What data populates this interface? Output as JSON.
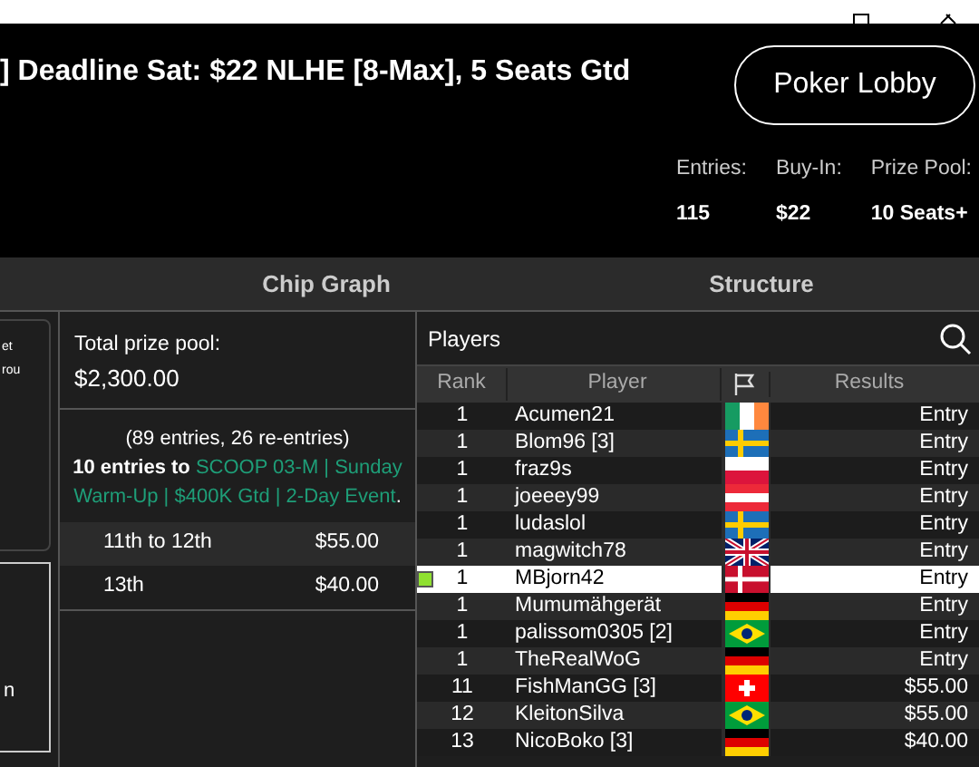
{
  "title": "] Deadline Sat: $22 NLHE [8-Max], 5 Seats Gtd",
  "lobby_button": "Poker Lobby",
  "stats": [
    {
      "label": "Entries:",
      "value": "115"
    },
    {
      "label": "Buy-In:",
      "value": "$22"
    },
    {
      "label": "Prize Pool:",
      "value": "10 Seats+"
    }
  ],
  "tabs": [
    {
      "label": "Chip Graph"
    },
    {
      "label": "Structure"
    }
  ],
  "side_fragments": [
    "et",
    "rou",
    "n"
  ],
  "prize": {
    "label": "Total prize pool:",
    "amount": "$2,300.00",
    "entries_note": "(89 entries, 26 re-entries)",
    "seats_lead": "10 entries to",
    "seats_event": "SCOOP 03-M | Sunday Warm-Up | $400K Gtd | 2-Day Event",
    "seats_end": ".",
    "places": [
      {
        "place": "11th to 12th",
        "amount": "$55.00"
      },
      {
        "place": "13th",
        "amount": "$40.00"
      }
    ]
  },
  "players": {
    "title": "Players",
    "columns": [
      "Rank",
      "Player",
      "Results"
    ],
    "rows": [
      {
        "rank": "1",
        "player": "Acumen21",
        "kind": "ie",
        "result": "Entry",
        "selected": false
      },
      {
        "rank": "1",
        "player": "Blom96 [3]",
        "kind": "se",
        "result": "Entry",
        "selected": false
      },
      {
        "rank": "1",
        "player": "fraz9s",
        "kind": "pl",
        "result": "Entry",
        "selected": false
      },
      {
        "rank": "1",
        "player": "joeeey99",
        "kind": "at",
        "result": "Entry",
        "selected": false
      },
      {
        "rank": "1",
        "player": "ludaslol",
        "kind": "se",
        "result": "Entry",
        "selected": false
      },
      {
        "rank": "1",
        "player": "magwitch78",
        "kind": "gb",
        "result": "Entry",
        "selected": false
      },
      {
        "rank": "1",
        "player": "MBjorn42",
        "kind": "dk",
        "result": "Entry",
        "selected": true
      },
      {
        "rank": "1",
        "player": "Mumumähgerät",
        "kind": "de",
        "result": "Entry",
        "selected": false
      },
      {
        "rank": "1",
        "player": "palissom0305 [2]",
        "kind": "br",
        "result": "Entry",
        "selected": false
      },
      {
        "rank": "1",
        "player": "TheRealWoG",
        "kind": "de",
        "result": "Entry",
        "selected": false
      },
      {
        "rank": "11",
        "player": "FishManGG [3]",
        "kind": "ch",
        "result": "$55.00",
        "selected": false
      },
      {
        "rank": "12",
        "player": "KleitonSilva",
        "kind": "br",
        "result": "$55.00",
        "selected": false
      },
      {
        "rank": "13",
        "player": "NicoBoko [3]",
        "kind": "de",
        "result": "$40.00",
        "selected": false
      }
    ]
  }
}
